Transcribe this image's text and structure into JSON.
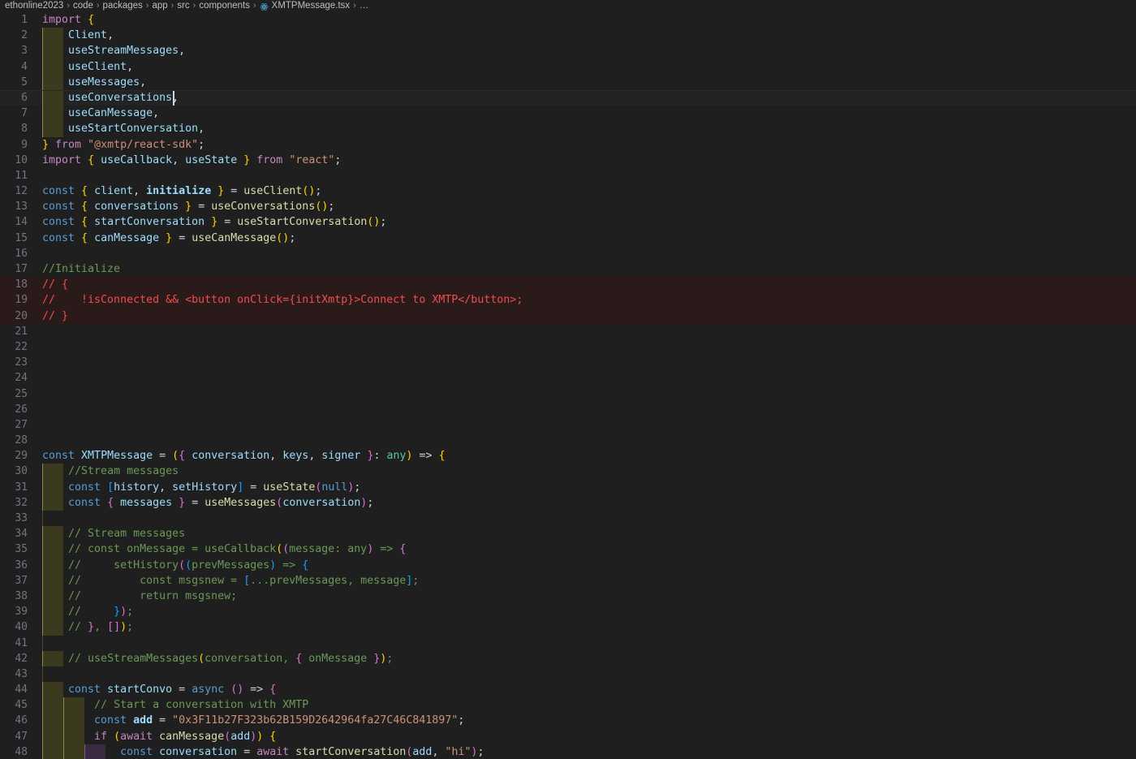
{
  "window": {
    "app": "Visual Studio Code",
    "theme_bg": "#1f1f1f",
    "accent": "#9cdcfe"
  },
  "breadcrumb": {
    "separator": "›",
    "overflow": "…",
    "file_icon": "react-icon",
    "items": [
      {
        "label": "ethonline2023",
        "kind": "folder"
      },
      {
        "label": "code",
        "kind": "folder"
      },
      {
        "label": "packages",
        "kind": "folder"
      },
      {
        "label": "app",
        "kind": "folder"
      },
      {
        "label": "src",
        "kind": "folder"
      },
      {
        "label": "components",
        "kind": "folder"
      },
      {
        "label": "XMTPMessage.tsx",
        "kind": "file"
      }
    ]
  },
  "editor": {
    "language": "typescriptreact",
    "file_name": "XMTPMessage.tsx",
    "cursor": {
      "line": 6,
      "column": 24
    },
    "first_visible_line": 1,
    "last_visible_line": 48,
    "colors": {
      "keyword_purple": "#c586c0",
      "keyword_blue": "#569cd6",
      "identifier": "#9cdcfe",
      "function": "#dcdcaa",
      "string": "#ce9178",
      "comment": "#6a9955",
      "type": "#4ec9b0",
      "error": "#f14c4c",
      "bracket1": "#ffd700",
      "bracket2": "#da70d6",
      "bracket3": "#179fff",
      "line_number": "#6e7681",
      "background": "#1f1f1f",
      "indent_guide_active": "#3b3a1f",
      "indent_guide_nested": "#3b2a40"
    },
    "lines": [
      {
        "n": 1,
        "text": "import {"
      },
      {
        "n": 2,
        "text": "    Client,"
      },
      {
        "n": 3,
        "text": "    useStreamMessages,"
      },
      {
        "n": 4,
        "text": "    useClient,"
      },
      {
        "n": 5,
        "text": "    useMessages,"
      },
      {
        "n": 6,
        "text": "    useConversations,"
      },
      {
        "n": 7,
        "text": "    useCanMessage,"
      },
      {
        "n": 8,
        "text": "    useStartConversation,"
      },
      {
        "n": 9,
        "text": "} from \"@xmtp/react-sdk\";"
      },
      {
        "n": 10,
        "text": "import { useCallback, useState } from \"react\";"
      },
      {
        "n": 11,
        "text": ""
      },
      {
        "n": 12,
        "text": "const { client, initialize } = useClient();"
      },
      {
        "n": 13,
        "text": "const { conversations } = useConversations();"
      },
      {
        "n": 14,
        "text": "const { startConversation } = useStartConversation();"
      },
      {
        "n": 15,
        "text": "const { canMessage } = useCanMessage();"
      },
      {
        "n": 16,
        "text": ""
      },
      {
        "n": 17,
        "text": "//Initialize"
      },
      {
        "n": 18,
        "text": "// {"
      },
      {
        "n": 19,
        "text": "//    !isConnected && <button onClick={initXmtp}>Connect to XMTP</button>;"
      },
      {
        "n": 20,
        "text": "// }"
      },
      {
        "n": 21,
        "text": ""
      },
      {
        "n": 22,
        "text": ""
      },
      {
        "n": 23,
        "text": ""
      },
      {
        "n": 24,
        "text": ""
      },
      {
        "n": 25,
        "text": ""
      },
      {
        "n": 26,
        "text": ""
      },
      {
        "n": 27,
        "text": ""
      },
      {
        "n": 28,
        "text": ""
      },
      {
        "n": 29,
        "text": "const XMTPMessage = ({ conversation, keys, signer }: any) => {"
      },
      {
        "n": 30,
        "text": "    //Stream messages"
      },
      {
        "n": 31,
        "text": "    const [history, setHistory] = useState(null);"
      },
      {
        "n": 32,
        "text": "    const { messages } = useMessages(conversation);"
      },
      {
        "n": 33,
        "text": ""
      },
      {
        "n": 34,
        "text": "    // Stream messages"
      },
      {
        "n": 35,
        "text": "    // const onMessage = useCallback((message: any) => {"
      },
      {
        "n": 36,
        "text": "    //     setHistory((prevMessages) => {"
      },
      {
        "n": 37,
        "text": "    //         const msgsnew = [...prevMessages, message];"
      },
      {
        "n": 38,
        "text": "    //         return msgsnew;"
      },
      {
        "n": 39,
        "text": "    //     });"
      },
      {
        "n": 40,
        "text": "    // }, []);"
      },
      {
        "n": 41,
        "text": ""
      },
      {
        "n": 42,
        "text": "    // useStreamMessages(conversation, { onMessage });"
      },
      {
        "n": 43,
        "text": ""
      },
      {
        "n": 44,
        "text": "    const startConvo = async () => {"
      },
      {
        "n": 45,
        "text": "        // Start a conversation with XMTP"
      },
      {
        "n": 46,
        "text": "        const add = \"0x3F11b27F323b62B159D2642964fa27C46C841897\";"
      },
      {
        "n": 47,
        "text": "        if (await canMessage(add)) {"
      },
      {
        "n": 48,
        "text": "            const conversation = await startConversation(add, \"hi\");"
      }
    ]
  }
}
